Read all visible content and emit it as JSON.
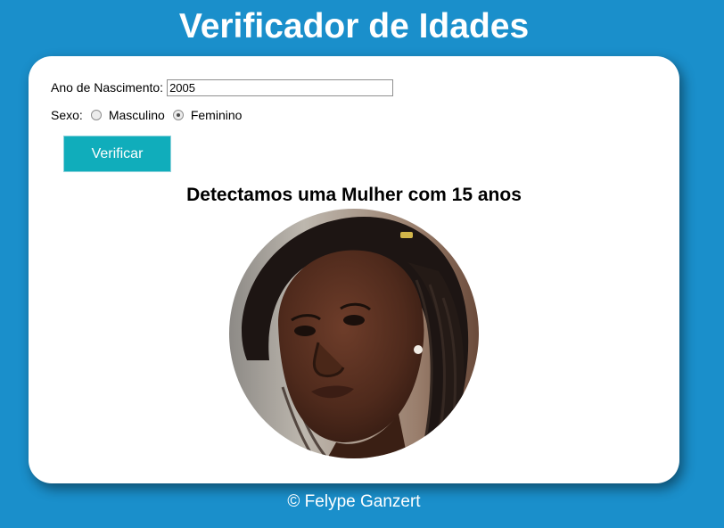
{
  "header": {
    "title": "Verificador de Idades"
  },
  "form": {
    "year_label": "Ano de Nascimento:",
    "year_value": "2005",
    "sex_label": "Sexo:",
    "sex_options": [
      {
        "label": "Masculino",
        "checked": false
      },
      {
        "label": "Feminino",
        "checked": true
      }
    ],
    "verify_button": "Verificar"
  },
  "result": {
    "text": "Detectamos uma Mulher com 15 anos",
    "image_icon": "young-woman-portrait"
  },
  "footer": {
    "credit": "© Felype Ganzert"
  },
  "colors": {
    "background": "#1a8fcb",
    "card": "#ffffff",
    "button": "#10adbb"
  }
}
